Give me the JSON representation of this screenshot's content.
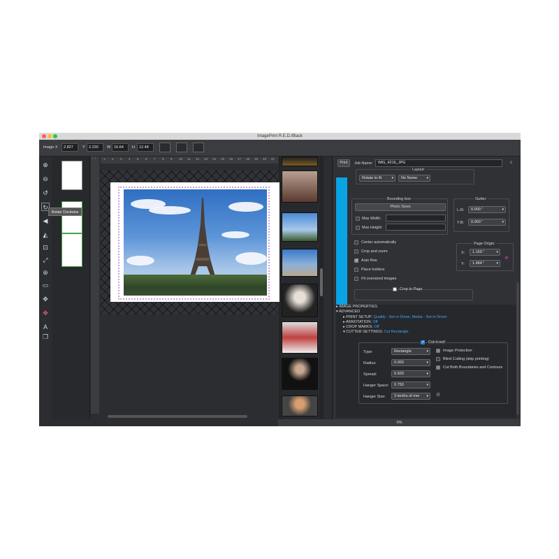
{
  "window": {
    "title": "ImagePrint R.E.D./Black"
  },
  "toolbar": {
    "image_label": "Image X",
    "x_value": "2.827",
    "y_label": "Y",
    "y_value": "2.230",
    "w_label": "W",
    "w_value": "16.64",
    "h_label": "H",
    "h_value": "12.48"
  },
  "tooltip": "Rotate Clockwise",
  "ruler_numbers": [
    "1",
    "2",
    "3",
    "4",
    "5",
    "6",
    "7",
    "8",
    "9",
    "10",
    "11",
    "12",
    "13",
    "14",
    "15",
    "16",
    "17",
    "18",
    "19",
    "20",
    "21"
  ],
  "right": {
    "print_label": "Print",
    "job_name_label": "Job Name:",
    "job_name_value": "IMG_4216_JPG",
    "layout_label": "Layout:",
    "rotate_value": "Rotate to fit",
    "name_value": "No Name",
    "bounding_box_label": "Bounding box:",
    "photo_sizes_label": "Photo Sizes",
    "max_width_label": "Max Width:",
    "max_height_label": "Max Height:",
    "gutter_label": "Gutter:",
    "lr_label": "L-R:",
    "lr_value": "0.000 \"",
    "tb_label": "T-B:",
    "tb_value": "0.000 \"",
    "center_label": "Center automatically",
    "crop_zoom_label": "Crop and zoom",
    "auto_flow_label": "Auto flow",
    "place_holders_label": "Place holders",
    "fit_oversized_label": "Fit oversized images",
    "page_origin_label": "Page Origin:",
    "x_label": "X:",
    "x_value": "1.169 \"",
    "y_label": "Y:",
    "y_value": "1.484 \"",
    "crop_to_page_label": "Crop to Page",
    "image_properties": "IMAGE PROPERTIES",
    "advanced": "ADVANCED",
    "print_setup_key": "PRINT SETUP:",
    "print_setup_value": "Quality - Set in Driver, Media - Set in Driver",
    "annotation_key": "ANNOTATION:",
    "annotation_value": "Off",
    "crop_marks_key": "CROP MARKS:",
    "crop_marks_value": "Off",
    "cutter_settings_key": "CUTTER SETTINGS:",
    "cutter_settings_value": "Cut Rectangle",
    "cut_it_out_label": "Cut-it-out!",
    "type_label": "Type:",
    "type_value": "Rectangle",
    "radius_label": "Radius:",
    "radius_value": "0.000",
    "spread_label": "Spread:",
    "spread_value": "0.500",
    "hanger_space_label": "Hanger Space:",
    "hanger_space_value": "0.750",
    "hanger_size_label": "Hanger Size:",
    "hanger_size_value": "3 tenths of mm",
    "image_protection_label": "Image Protection",
    "blind_cutting_label": "Blind Cutting (skip printing)",
    "cut_both_label": "Cut Both Boundaries and Contours"
  },
  "status": {
    "progress_text": "0%"
  },
  "colors": {
    "accent_blue": "#0aa3e3",
    "link_blue": "#3fa8ff",
    "cut_line": "#c8a0d8"
  }
}
